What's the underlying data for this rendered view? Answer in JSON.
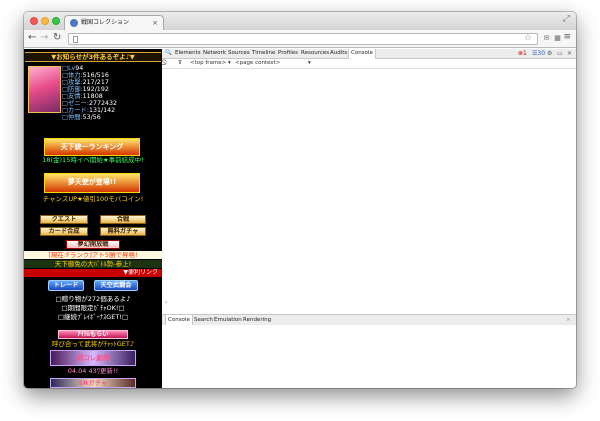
{
  "tab": {
    "title": "戦国コレクション"
  },
  "colors": {
    "accent_gold": "#ffcc33",
    "game_bg": "#000000",
    "devtools_active": "#ffffff",
    "error_red": "#d00000",
    "warn_blue": "#3060c0"
  },
  "browser": {
    "nav_icons": [
      "back-arrow-icon",
      "forward-arrow-icon",
      "reload-icon"
    ],
    "extension_icons": [
      "mail-extension-icon",
      "qr-extension-icon"
    ],
    "url": "",
    "errors_count": "1",
    "warnings_count": "30"
  },
  "game": {
    "notice": "▼お知らせが3件あるぞよ♪▼",
    "stats": [
      {
        "k": "□Lv",
        "v": "94"
      },
      {
        "k": "□体力:",
        "v": "516/516"
      },
      {
        "k": "□攻撃:",
        "v": "217/217"
      },
      {
        "k": "□防御:",
        "v": "192/192"
      },
      {
        "k": "□友情:",
        "v": "11808"
      },
      {
        "k": "□ゼニー:",
        "v": "2772432"
      },
      {
        "k": "□カード:",
        "v": "131/142"
      },
      {
        "k": "□仲間:",
        "v": "53/56"
      }
    ],
    "event_banner": "天下統一ランキング",
    "event_text": "18(金)15時イベ開始★事前結成中!",
    "gacha_banner": "夢天使が登場!!",
    "gacha_text": "チャンスUP★値引100モバコイン!",
    "buttons": {
      "quest": "クエスト",
      "battle": "合戦",
      "card_synth": "カード合成",
      "free_gacha": "無料ガチャ",
      "matsuri": "夢幻開放戦"
    },
    "rank_text": "[現在:Fランク]アト5勝で昇格!",
    "tenka_text": "天下御免の大ﾊﾞﾄﾙ勢-参上!",
    "convenient_links": "▼便利リンク",
    "trade": "トレード",
    "teppou": "天空武闘会",
    "gift_text": "□贈り物が272個あるよ♪",
    "limited_text": "□期間限定ｶﾞﾁｬOK!□",
    "daily_text": "□継続ﾌﾟﾚｲﾎﾞｰﾅｽGET!□",
    "item_banner": "ｱｲﾃﾑもらい",
    "call_text": "呼び合って武将がﾁｬｯﾄGET♪",
    "theater": "戦コレ劇場",
    "theater_date": "04.04 43ﾜ更新!!",
    "bottom_banner": "SRガチャ"
  },
  "devtools": {
    "tabs": [
      "Elements",
      "Network",
      "Sources",
      "Timeline",
      "Profiles",
      "Resources",
      "Audits",
      "Console"
    ],
    "active_tab": "Console",
    "frame_select": "<top frame>",
    "context_select": "<page context>",
    "prompt": "›",
    "drawer_tabs": [
      "Console",
      "Search",
      "Emulation",
      "Rendering"
    ]
  }
}
